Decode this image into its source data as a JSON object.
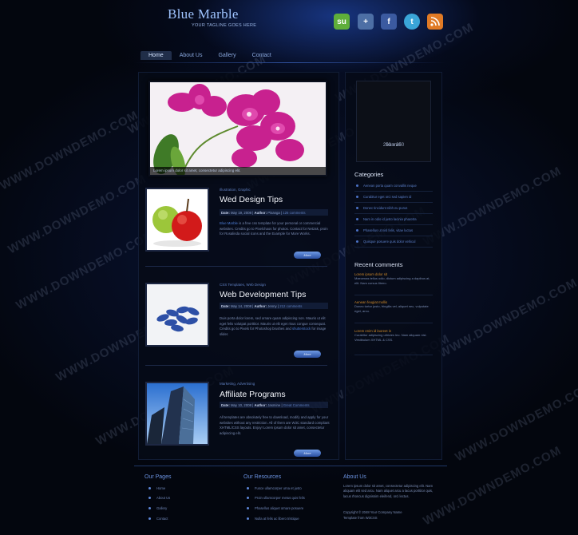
{
  "site": {
    "title": "Blue Marble",
    "tagline": "YOUR TAGLINE GOES HERE"
  },
  "social": [
    {
      "name": "stumbleupon-icon",
      "glyph": "su",
      "color": "#5fae3a"
    },
    {
      "name": "digg-icon",
      "glyph": "+",
      "color": "#4d6fa5"
    },
    {
      "name": "facebook-icon",
      "glyph": "f",
      "color": "#3b5aa0"
    },
    {
      "name": "twitter-icon",
      "glyph": "t",
      "color": "#3aa5d8"
    },
    {
      "name": "rss-icon",
      "glyph": ")",
      "color": "#e07a25"
    }
  ],
  "nav": [
    "Home",
    "About Us",
    "Gallery",
    "Contact"
  ],
  "hero": {
    "caption": "Lorem ipsum dolor sit amet, consectetur adipiscing elit."
  },
  "posts": [
    {
      "category": "Illustration, Graphic",
      "title": "Wed Design Tips",
      "date_label": "Date:",
      "date": "May 19, 2008",
      "author_label": "Author:",
      "author": "Pisanga",
      "comments": "126 comments",
      "text_hl": "Blue Marble",
      "text": "is a free css template for your personal or commercial websites. Credits go to Pixelchaos for photos. Contact for Netzak, proin for Rosalinda social icons and the Example for More Works.",
      "more": "More"
    },
    {
      "category": "CSS Templates, Web Design",
      "title": "Web Development Tips",
      "date_label": "Date:",
      "date": "May 14, 2008",
      "author_label": "Author:",
      "author": "Jenny",
      "comments": "212 comments",
      "text": "Duis porta dolor lorem, sed ornare quam adipiscing non. Mauris ut elit eget felis volutpat porttitor. Mauris ut elit eget risus congue consequat. Credits go to Pixels for Photoshop brushes and ",
      "text_hl": "shutterstock",
      "text_tail": " for image slider.",
      "more": "More"
    },
    {
      "category": "Marketing, Advertising",
      "title": "Affiliate Programs",
      "date_label": "Date:",
      "date": "May 10, 2008",
      "author_label": "Author:",
      "author": "Jasmine",
      "comments": "Great Comments",
      "text": "All templates are absolutely free to download, modify and apply for your websites without any restriction. All of them are W3C standard compliant XHTML/CSS layouts. Enjoy! Lorem ipsum dolor sit amet, consectetur adipiscing elit.",
      "more": "More"
    }
  ],
  "sidebar": {
    "banner_size": "250 x 250",
    "banner_label": "banner",
    "categories_title": "Categories",
    "categories": [
      "Aenean porta quam convallis neque",
      "Curabitur eget orci sed sapien id",
      "Donec tincidunt nibh eu purus",
      "Nam in odio id justo lacinia pharetra",
      "Phasellus ut nisl felis, vitae luctus",
      "Quisque posuere quis dolor vehicul"
    ],
    "comments_title": "Recent comments",
    "comments": [
      {
        "author": "Lorem ipsum dolor sit",
        "text": "Maecenas tellus odio, dictum adipiscing a dapibus at, elit. Nam cursus libero."
      },
      {
        "author": "Aenean feugiat mollis",
        "text": "Donec tortor justo, fringilla vel, aliquet nec, vulputate eget, arcu."
      },
      {
        "author": "Lorem enim id laoreet in",
        "text": "Curabitur adipiscing ultricies leo. Nam aliquam nisl. Vestibulum XHTML & CSS."
      }
    ]
  },
  "footer": {
    "pages_title": "Our Pages",
    "pages": [
      "Home",
      "About Us",
      "Gallery",
      "Contact"
    ],
    "resources_title": "Our Resources",
    "resources": [
      "Fusce ullamcorper urna et justo",
      "Proin ullamcorper metus quis felis",
      "Phasellus aliquet ornare posuere",
      "Nulla at felis ac libero tristique"
    ],
    "about_title": "About Us",
    "about_text": "Lorem ipsum dolor sit amet, consectetur adipiscing elit. Nam aliquam elit sed arcu. Nam aliquet arcu a lacus porttitor quis, lacus rhoncus dignissim eleifend, orci lectus.",
    "copyright": "Copyright © 2048 Your Company Name",
    "credit": "Template from W3CSS"
  },
  "watermark": "WWW.DOWNDEMO.COM"
}
